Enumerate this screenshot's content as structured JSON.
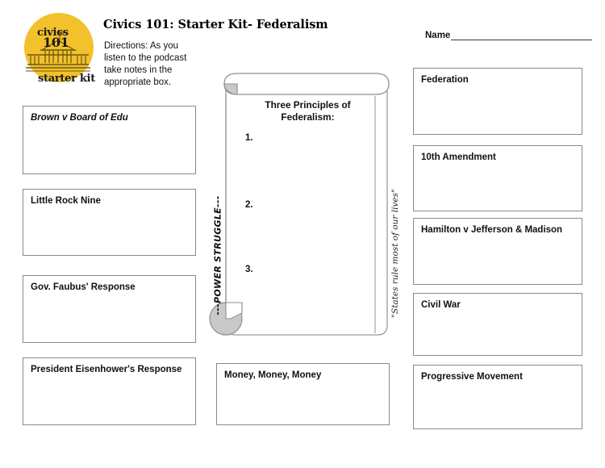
{
  "document": {
    "title": "Civics 101: Starter Kit- Federalism",
    "directions": "Directions: As you listen to the podcast take notes in the appropriate box."
  },
  "logo": {
    "word_top": "civics",
    "word_number": "101",
    "word_bottom": "starter kit",
    "icon": "white-house-icon",
    "circle_color": "#f2c12b"
  },
  "name_field": {
    "label": "Name",
    "value": ""
  },
  "left_column": [
    {
      "label": "Brown v Board of Edu",
      "style": "italic",
      "value": ""
    },
    {
      "label": "Little Rock Nine",
      "style": "normal",
      "value": ""
    },
    {
      "label": "Gov. Faubus' Response",
      "style": "normal",
      "value": ""
    },
    {
      "label": "President Eisenhower's Response",
      "style": "normal",
      "value": ""
    }
  ],
  "center": {
    "scroll_heading": "Three Principles of Federalism:",
    "principles": [
      "1.",
      "2.",
      "3."
    ],
    "money_box": {
      "label": "Money, Money, Money",
      "value": ""
    }
  },
  "right_column": [
    {
      "label": "Federation",
      "value": ""
    },
    {
      "label": "10th Amendment",
      "value": ""
    },
    {
      "label": "Hamilton v Jefferson & Madison",
      "value": ""
    },
    {
      "label": "Civil War",
      "value": ""
    },
    {
      "label": "Progressive Movement",
      "value": ""
    }
  ],
  "annotations": {
    "left_vertical": "---POWER STRUGGLE---",
    "right_vertical": "\"States rule most of our lives\""
  }
}
